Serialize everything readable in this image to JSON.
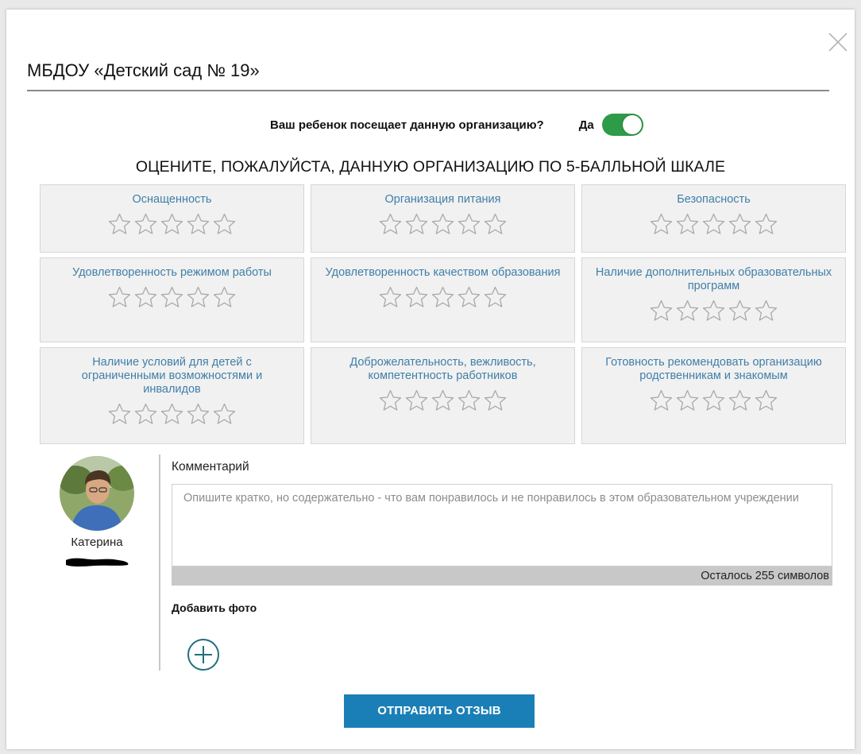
{
  "modal": {
    "title": "МБДОУ «Детский сад № 19»"
  },
  "attendance": {
    "question": "Ваш ребенок посещает данную организацию?",
    "answer_label": "Да",
    "toggle_on": true,
    "toggle_color": "#2e9b48"
  },
  "rating": {
    "heading": "ОЦЕНИТЕ, ПОЖАЛУЙСТА, ДАННУЮ ОРГАНИЗАЦИЮ ПО 5-БАЛЛЬНОЙ ШКАЛЕ",
    "max_stars": 5,
    "criteria": [
      {
        "label": "Оснащенность",
        "rating": 0
      },
      {
        "label": "Организация питания",
        "rating": 0
      },
      {
        "label": "Безопасность",
        "rating": 0
      },
      {
        "label": "Удовлетворенность режимом работы",
        "rating": 0
      },
      {
        "label": "Удовлетворенность качеством образования",
        "rating": 0
      },
      {
        "label": "Наличие дополнительных образовательных программ",
        "rating": 0
      },
      {
        "label": "Наличие условий для детей с ограниченными возможностями и инвалидов",
        "rating": 0
      },
      {
        "label": "Доброжелательность, вежливость, компетентность работников",
        "rating": 0
      },
      {
        "label": "Готовность рекомендовать организацию родственникам и знакомым",
        "rating": 0
      }
    ],
    "label_color": "#3f7fa9",
    "star_outline_color": "#a9a9a9"
  },
  "user": {
    "name": "Катерина"
  },
  "comment": {
    "label": "Комментарий",
    "value": "",
    "placeholder": "Опишите кратко, но содержательно - что вам понравилось и не понравилось в этом образовательном учреждении",
    "remaining_text": "Осталось 255 символов"
  },
  "photo": {
    "label": "Добавить фото"
  },
  "submit": {
    "label": "ОТПРАВИТЬ ОТЗЫВ",
    "color": "#1a7fb6"
  },
  "icons": {
    "close": "close-icon",
    "star": "star-outline-icon",
    "add": "plus-circle-icon"
  }
}
